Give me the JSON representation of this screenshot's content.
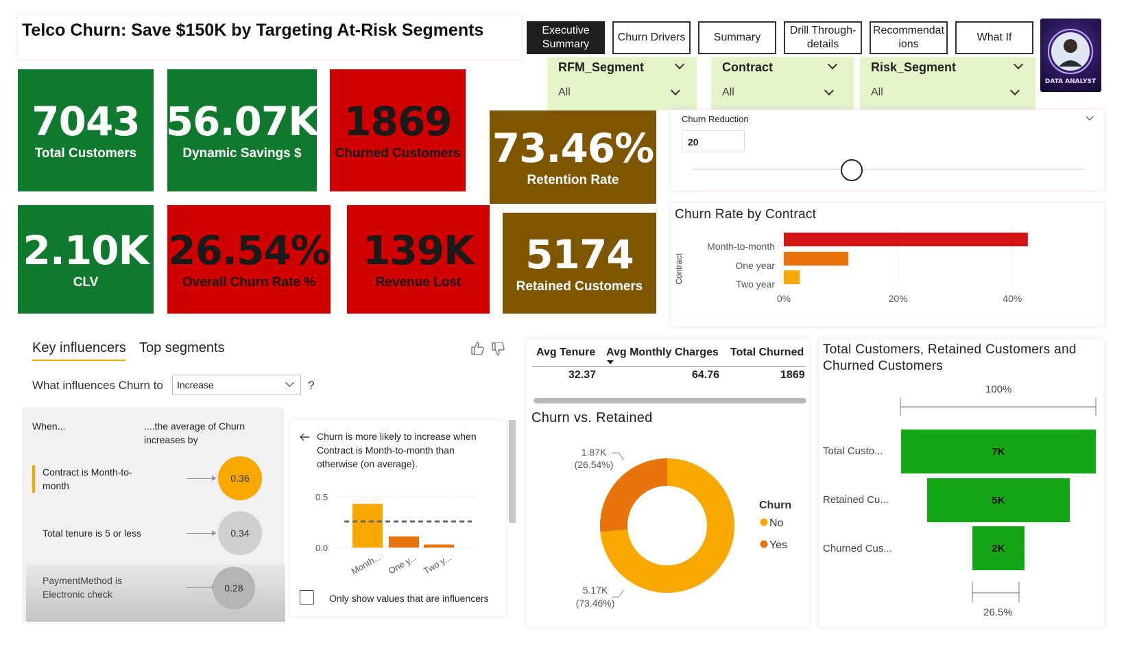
{
  "title": "Telco Churn: Save $150K by Targeting At-Risk Segments",
  "nav": [
    {
      "label": "Executive Summary"
    },
    {
      "label": "Churn Drivers"
    },
    {
      "label": "Summary"
    },
    {
      "label": "Drill Through-details"
    },
    {
      "label": "Recommendations"
    },
    {
      "label": "What If"
    }
  ],
  "slicers": [
    {
      "title": "RFM_Segment",
      "value": "All"
    },
    {
      "title": "Contract",
      "value": "All"
    },
    {
      "title": "Risk_Segment",
      "value": "All"
    }
  ],
  "avatar_text": "DATA ANALYST",
  "kpis": [
    {
      "value": "7043",
      "label": "Total Customers",
      "color": "#0f7a2e"
    },
    {
      "value": "56.07K",
      "label": "Dynamic Savings $",
      "color": "#0f7a2e"
    },
    {
      "value": "1869",
      "label": "Churned Customers",
      "color": "#d00000"
    },
    {
      "value": "73.46%",
      "label": "Retention Rate",
      "color": "#7e5600"
    },
    {
      "value": "2.10K",
      "label": "CLV",
      "color": "#0f7a2e"
    },
    {
      "value": "26.54%",
      "label": "Overall Churn Rate %",
      "color": "#d00000"
    },
    {
      "value": "139K",
      "label": "Revenue Lost",
      "color": "#d00000"
    },
    {
      "value": "5174",
      "label": "Retained Customers",
      "color": "#7e5600"
    }
  ],
  "churn_reduction": {
    "label": "Churn Reduction",
    "value": "20"
  },
  "churn_rate_by_contract": {
    "title": "Churn Rate by Contract",
    "ylabel": "Contract",
    "categories": [
      "Month-to-month",
      "One year",
      "Two year"
    ],
    "values": [
      42.7,
      11.3,
      2.8
    ],
    "colors": [
      "#d21414",
      "#e8720c",
      "#f8a800"
    ],
    "xticks": [
      "0%",
      "20%",
      "40%"
    ],
    "xtick_values": [
      0,
      20,
      40
    ],
    "xmax": 45
  },
  "key_influencers": {
    "tabs": [
      "Key influencers",
      "Top segments"
    ],
    "question": "What influences Churn to",
    "select_value": "Increase",
    "qmark": "?",
    "col_when": "When...",
    "col_avg": "....the average of Churn increases by",
    "rows": [
      {
        "text": "Contract is Month-to-month",
        "value": "0.36"
      },
      {
        "text": "Total tenure is 5 or less",
        "value": "0.34"
      },
      {
        "text": "PaymentMethod is Electronic check",
        "value": "0.28"
      }
    ],
    "detail_text": "Churn is more likely to increase when Contract is Month-to-month than otherwise (on average).",
    "detail_chart": {
      "categories": [
        "Month...",
        "One y...",
        "Two y..."
      ],
      "values": [
        0.43,
        0.11,
        0.03
      ],
      "average": 0.27,
      "yticks": [
        "0.5",
        "0.0"
      ]
    },
    "checkbox_label": "Only show values that are influencers"
  },
  "stats": {
    "headers": [
      "Avg Tenure",
      "Avg Monthly Charges",
      "Total Churned"
    ],
    "values": [
      "32.37",
      "64.76",
      "1869"
    ]
  },
  "churn_vs_retained": {
    "title": "Churn vs. Retained",
    "legend_title": "Churn",
    "slices": [
      {
        "name": "No",
        "value": 5174,
        "label": "5.17K",
        "pct": "(73.46%)",
        "color": "#f9a800"
      },
      {
        "name": "Yes",
        "value": 1869,
        "label": "1.87K",
        "pct": "(26.54%)",
        "color": "#e8720c"
      }
    ]
  },
  "funnel": {
    "title": "Total Customers, Retained Customers and Churned Customers",
    "top_label": "100%",
    "bottom_label": "26.5%",
    "stages": [
      {
        "label": "Total Custo...",
        "value": 7043,
        "display": "7K"
      },
      {
        "label": "Retained Cu...",
        "value": 5174,
        "display": "5K"
      },
      {
        "label": "Churned Cus...",
        "value": 1869,
        "display": "2K"
      }
    ]
  },
  "chart_data": [
    {
      "type": "bar",
      "title": "Churn Rate by Contract",
      "categories": [
        "Month-to-month",
        "One year",
        "Two year"
      ],
      "values": [
        42.7,
        11.3,
        2.8
      ],
      "xlabel": "",
      "ylabel": "Contract",
      "xlim": [
        0,
        45
      ]
    },
    {
      "type": "pie",
      "title": "Churn vs. Retained",
      "categories": [
        "No",
        "Yes"
      ],
      "values": [
        5174,
        1869
      ]
    },
    {
      "type": "bar",
      "title": "Total Customers, Retained Customers and Churned Customers",
      "categories": [
        "Total Customers",
        "Retained Customers",
        "Churned Customers"
      ],
      "values": [
        7043,
        5174,
        1869
      ]
    }
  ]
}
